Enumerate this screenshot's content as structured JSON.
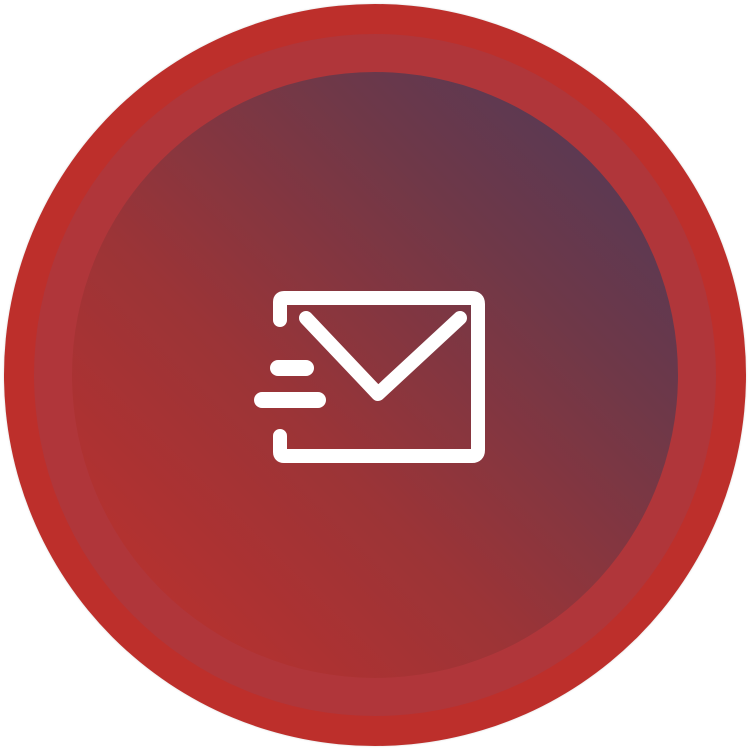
{
  "colors": {
    "outer": "#bd2f2b",
    "ring": "#b0363a",
    "gradient_start": "#c1302c",
    "gradient_end": "#4b3a5b",
    "icon": "#ffffff"
  },
  "icon": "send-mail-icon"
}
